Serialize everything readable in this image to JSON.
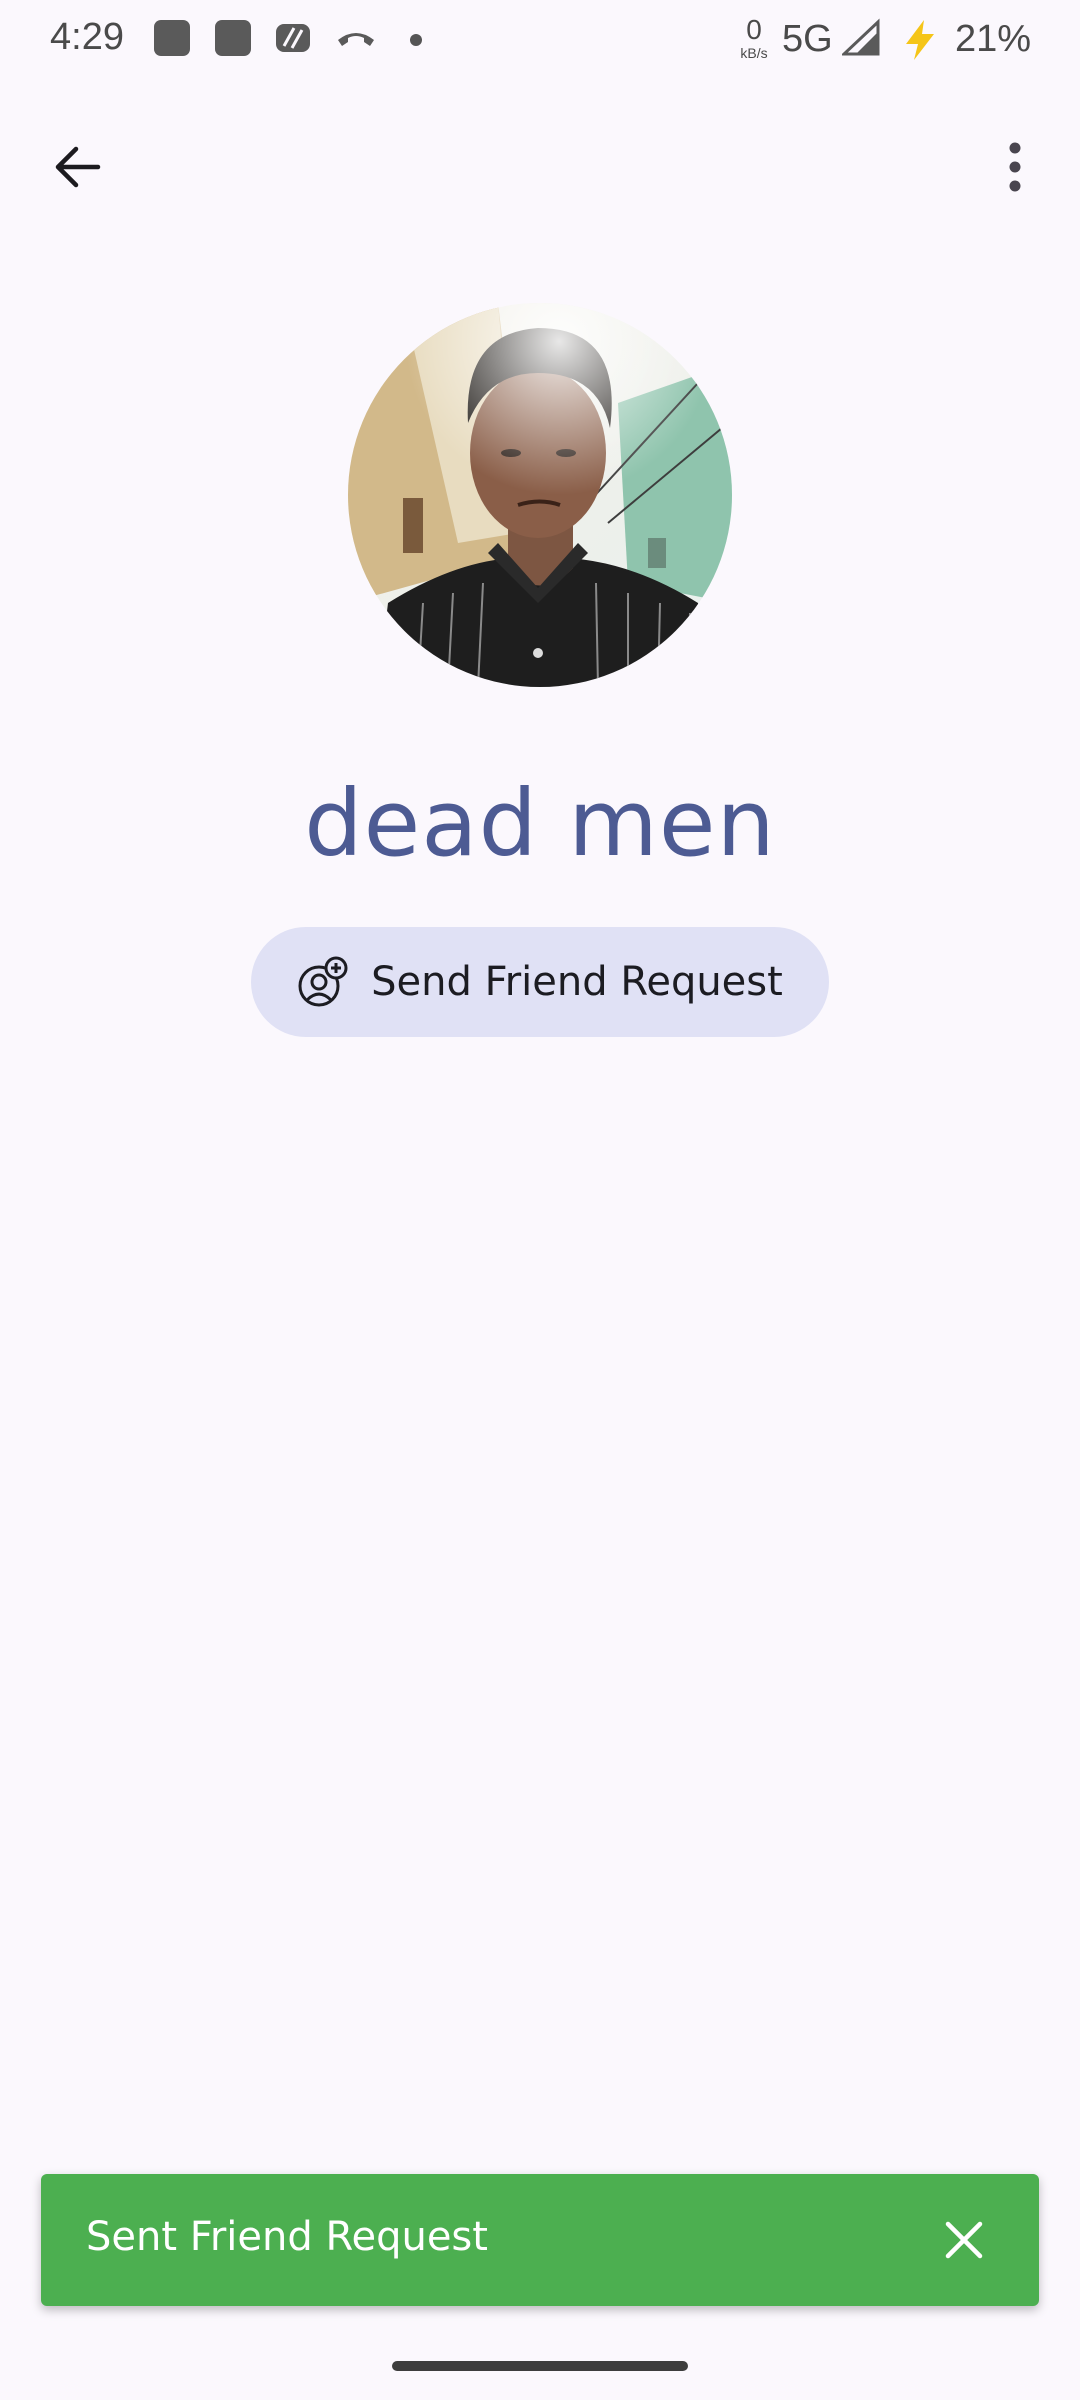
{
  "status_bar": {
    "time": "4:29",
    "net_speed_value": "0",
    "net_speed_unit": "kB/s",
    "network": "5G",
    "battery": "21%"
  },
  "top_bar": {
    "back_icon": "arrow-back-icon",
    "more_icon": "more-vert-icon"
  },
  "profile": {
    "avatar": "profile-photo",
    "name": "dead men",
    "action_icon": "person-add-icon",
    "action_label": "Send Friend Request"
  },
  "snackbar": {
    "message": "Sent Friend Request",
    "close_icon": "close-icon",
    "color": "#4caf50"
  },
  "colors": {
    "background": "#fbf8fd",
    "name_color": "#4d5b93",
    "button_bg": "#e0e1f5"
  }
}
